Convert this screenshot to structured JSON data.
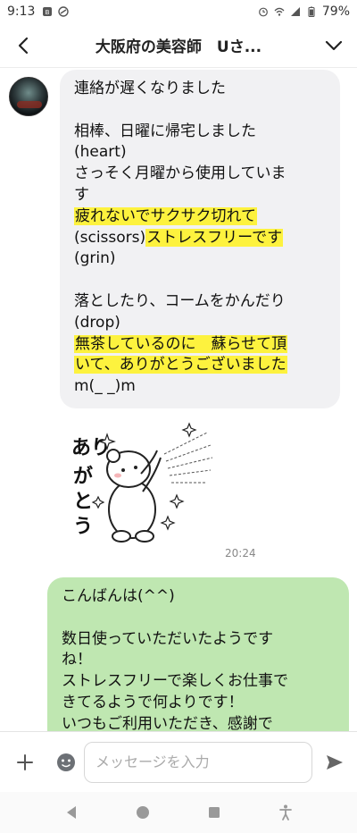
{
  "status_bar": {
    "time": "9:13",
    "battery": "79%"
  },
  "header": {
    "title": "大阪府の美容師　Uさ..."
  },
  "incoming": {
    "lines": [
      {
        "text": "連絡が遅くなりました",
        "highlight": false
      },
      {
        "text": "",
        "highlight": false
      },
      {
        "text": "相棒、日曜に帰宅しました",
        "highlight": false
      },
      {
        "text": "(heart)",
        "highlight": false
      },
      {
        "text": "さっそく月曜から使用していま",
        "highlight": false
      },
      {
        "text": "す",
        "highlight": false
      },
      {
        "text": "疲れないでサクサク切れて",
        "highlight": true
      },
      {
        "pre": "(scissors)",
        "text": "ストレスフリーです",
        "highlight": true
      },
      {
        "text": "(grin)",
        "highlight": false
      },
      {
        "text": "",
        "highlight": false
      },
      {
        "text": "落としたり、コームをかんだり",
        "highlight": false
      },
      {
        "text": "(drop)",
        "highlight": false
      },
      {
        "text": "無茶しているのに　蘇らせて頂",
        "highlight": true
      },
      {
        "text": "いて、ありがとうございました",
        "highlight": true
      },
      {
        "text": "m(_ _)m",
        "highlight": false
      }
    ],
    "sticker": {
      "text_line1": "あり",
      "text_line2": "がとう",
      "icon": "bear-thank-you-sticker"
    },
    "time": "20:24"
  },
  "outgoing": {
    "lines": [
      "こんばんは(^^)",
      "",
      "数日使っていただいたようです",
      "ね！",
      "ストレスフリーで楽しくお仕事で",
      "きてるようで何よりです！",
      "いつもご利用いただき、感謝で"
    ]
  },
  "input": {
    "placeholder": "メッセージを入力"
  },
  "colors": {
    "highlight": "#fdf23e",
    "incoming_bubble": "#f1f1f3",
    "outgoing_bubble": "#bfe7b1"
  }
}
